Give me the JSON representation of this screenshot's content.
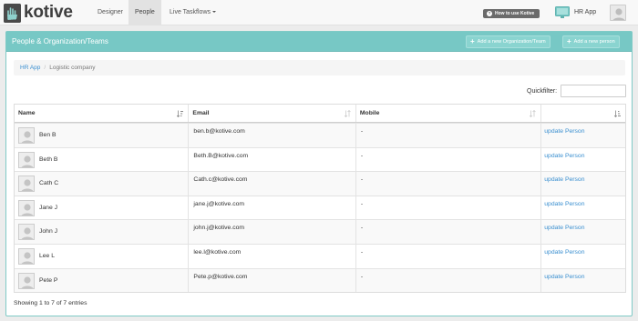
{
  "app": {
    "logo_text": "kotive",
    "logo_icon": "kotive-hand-icon"
  },
  "nav": {
    "designer": "Designer",
    "people": "People",
    "live_taskflows": "Live Taskflows",
    "how_to_use": "How to use Kotive",
    "app_name": "HR App"
  },
  "panel": {
    "title": "People & Organization/Teams",
    "add_org_label": "Add a new Organization/Team",
    "add_person_label": "Add a new person"
  },
  "breadcrumb": {
    "items": [
      "HR App",
      "Logistic company"
    ]
  },
  "quickfilter": {
    "label": "Quickfilter:",
    "value": "",
    "placeholder": ""
  },
  "table": {
    "columns": [
      "Name",
      "Email",
      "Mobile",
      ""
    ],
    "rows": [
      {
        "name": "Ben B",
        "email": "ben.b@kotive.com",
        "mobile": "-",
        "action": "update Person"
      },
      {
        "name": "Beth B",
        "email": "Beth.B@kotive.com",
        "mobile": "-",
        "action": "update Person"
      },
      {
        "name": "Cath C",
        "email": "Cath.c@kotive.com",
        "mobile": "-",
        "action": "update Person"
      },
      {
        "name": "Jane J",
        "email": "jane.j@kotive.com",
        "mobile": "-",
        "action": "update Person"
      },
      {
        "name": "John J",
        "email": "john.j@kotive.com",
        "mobile": "-",
        "action": "update Person"
      },
      {
        "name": "Lee L",
        "email": "lee.l@kotive.com",
        "mobile": "-",
        "action": "update Person"
      },
      {
        "name": "Pete P",
        "email": "Pete.p@kotive.com",
        "mobile": "-",
        "action": "update Person"
      }
    ],
    "footer": "Showing 1 to 7 of 7 entries"
  },
  "colors": {
    "panel_header": "#77c8c5",
    "link": "#3a8fd0",
    "howto_button": "#6b6b6b"
  }
}
